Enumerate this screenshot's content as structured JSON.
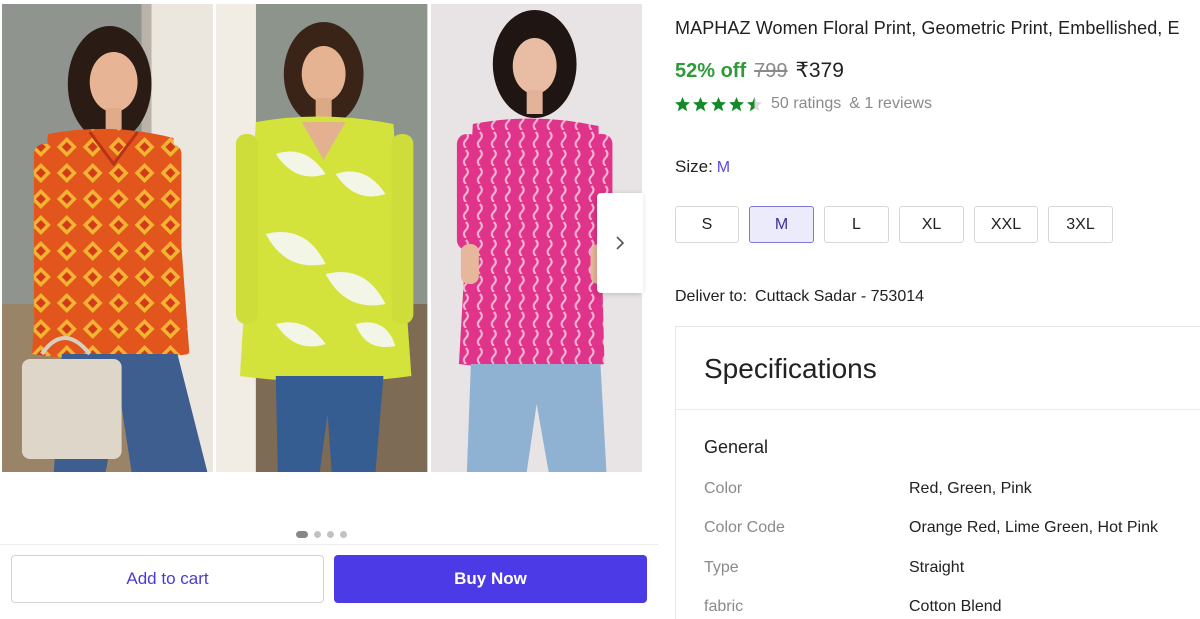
{
  "gallery": {
    "photos": [
      {
        "icon": "model-orange-red-kurti-photo",
        "top_color": "#e2561e",
        "pattern_color": "#f2b431"
      },
      {
        "icon": "model-lime-green-kurti-photo",
        "top_color": "#d4e33b",
        "pattern_color": "#f3f6e6"
      },
      {
        "icon": "model-hot-pink-kurti-photo",
        "top_color": "#e0348a",
        "pattern_color": "#f7b7d6"
      }
    ],
    "next_icon": "chevron-right-icon",
    "dot_count": 4,
    "active_dot": 0
  },
  "actions": {
    "add_to_cart": "Add to cart",
    "buy_now": "Buy Now"
  },
  "product": {
    "title": "MAPHAZ Women Floral Print, Geometric Print, Embellished, E",
    "discount": "52% off",
    "mrp": "799",
    "price": "₹379",
    "rating_value": 4.5,
    "ratings": "50 ratings",
    "reviews": "& 1 reviews"
  },
  "size": {
    "label": "Size:",
    "selected": "M",
    "options": [
      "S",
      "M",
      "L",
      "XL",
      "XXL",
      "3XL"
    ]
  },
  "delivery": {
    "label": "Deliver to:",
    "location": "Cuttack Sadar - 753014"
  },
  "specifications": {
    "title": "Specifications",
    "group": "General",
    "rows": [
      {
        "key": "Color",
        "value": "Red, Green, Pink"
      },
      {
        "key": "Color Code",
        "value": "Orange Red, Lime Green, Hot Pink"
      },
      {
        "key": "Type",
        "value": "Straight"
      },
      {
        "key": "fabric",
        "value": "Cotton Blend"
      }
    ]
  },
  "colors": {
    "accent": "#4b3ae5",
    "discount_green": "#2e9b3a",
    "star_green": "#148a2b"
  }
}
